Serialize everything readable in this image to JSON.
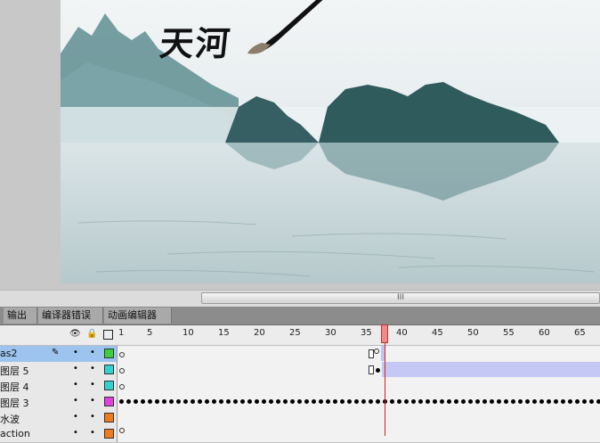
{
  "artwork": {
    "calligraphy": "天河",
    "colors": {
      "sky": "#eef2f3",
      "mountain": "#2f5c5e",
      "mist": "#dfe8ea",
      "water": "#c9d8db"
    }
  },
  "scrollbar": {
    "grip": "III"
  },
  "panel_tabs": [
    "输出",
    "编译器错误",
    "动画编辑器"
  ],
  "timeline": {
    "header_icons": [
      "eye-icon",
      "lock-icon",
      "outline-icon"
    ],
    "ruler_numbers": [
      "1",
      "5",
      "10",
      "15",
      "20",
      "25",
      "30",
      "35",
      "40",
      "45",
      "50",
      "55",
      "60",
      "65"
    ],
    "current_frame": 38,
    "layers": [
      {
        "name": "as2",
        "selected": true,
        "color": "#3ccf3c",
        "icons": [
          "pencil-icon"
        ]
      },
      {
        "name": "图层 5",
        "selected": false,
        "color": "#33d0d0"
      },
      {
        "name": "图层 4",
        "selected": false,
        "color": "#33d0d0"
      },
      {
        "name": "图层 3",
        "selected": false,
        "color": "#e040e0"
      },
      {
        "name": "水波",
        "selected": false,
        "color": "#f07a20"
      },
      {
        "name": "action",
        "selected": false,
        "color": "#f07a20"
      }
    ]
  }
}
